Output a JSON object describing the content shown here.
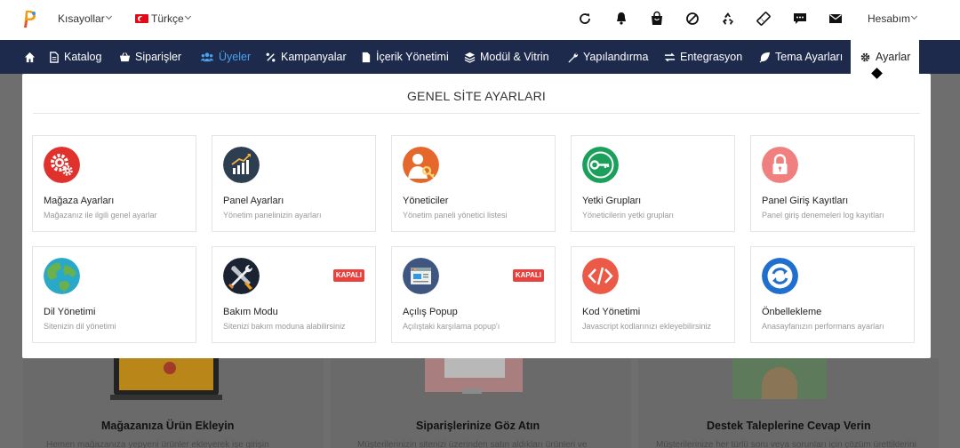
{
  "topbar": {
    "shortcuts_label": "Kısayollar",
    "language_label": "Türkçe",
    "account_label": "Hesabım",
    "icons": [
      "refresh-icon",
      "bell-icon",
      "shopping-bag-icon",
      "ban-icon",
      "recycle-icon",
      "ticket-icon",
      "chat-icon",
      "mail-icon"
    ]
  },
  "nav": {
    "items": [
      {
        "label": ""
      },
      {
        "label": "Katalog"
      },
      {
        "label": "Siparişler"
      },
      {
        "label": "Üyeler"
      },
      {
        "label": "Kampanyalar"
      },
      {
        "label": "İçerik Yönetimi"
      },
      {
        "label": "Modül & Vitrin"
      },
      {
        "label": "Yapılandırma"
      },
      {
        "label": "Entegrasyon"
      },
      {
        "label": "Tema Ayarları"
      },
      {
        "label": "Ayarlar"
      }
    ],
    "active_color": "#4aa3f0",
    "background": "#1d2a4b"
  },
  "panel": {
    "title": "GENEL SİTE AYARLARI",
    "cards": [
      {
        "title": "Mağaza Ayarları",
        "desc": "Mağazanız ile ilgili genel ayarlar",
        "icon": "gears-icon",
        "color": "#e0312c"
      },
      {
        "title": "Panel Ayarları",
        "desc": "Yönetim panelinizin ayarları",
        "icon": "chart-icon",
        "color": "#2d3e50"
      },
      {
        "title": "Yöneticiler",
        "desc": "Yönetim paneli yönetici listesi",
        "icon": "admin-key-icon",
        "color": "#e6672c"
      },
      {
        "title": "Yetki Grupları",
        "desc": "Yöneticilerin yetki grupları",
        "icon": "key-icon",
        "color": "#1aa05b"
      },
      {
        "title": "Panel Giriş Kayıtları",
        "desc": "Panel giriş denemeleri log kayıtları",
        "icon": "lock-icon",
        "color": "#f08080"
      },
      {
        "title": "Dil Yönetimi",
        "desc": "Sitenizin dil yönetimi",
        "icon": "globe-icon",
        "color": "#2aa8c8"
      },
      {
        "title": "Bakım Modu",
        "desc": "Sitenizi bakım moduna alabilirsiniz",
        "icon": "tools-icon",
        "color": "#1b2333",
        "badge": "KAPALI"
      },
      {
        "title": "Açılış Popup",
        "desc": "Açılıştaki karşılama popup'ı",
        "icon": "window-icon",
        "color": "#3e5680",
        "badge": "KAPALI"
      },
      {
        "title": "Kod Yönetimi",
        "desc": "Javascript kodlarınızı ekleyebilirsiniz",
        "icon": "code-icon",
        "color": "#ea5a47"
      },
      {
        "title": "Önbellekleme",
        "desc": "Anasayfanızın performans ayarları",
        "icon": "sync-icon",
        "color": "#1f6fcf"
      }
    ]
  },
  "background": {
    "cards": [
      {
        "title": "Mağazanıza Ürün Ekleyin",
        "desc": "Hemen mağazanıza yepyeni ürünler ekleyerek işe girişin"
      },
      {
        "title": "Siparişlerinize Göz Atın",
        "desc": "Müşterilerinizin sitenizi üzerinden satın aldıkları ürünleri ve"
      },
      {
        "title": "Destek Taleplerine Cevap Verin",
        "desc": "Müşterilerinize her türlü soru veya sorunları için çözüm ürettiklerini"
      }
    ]
  }
}
